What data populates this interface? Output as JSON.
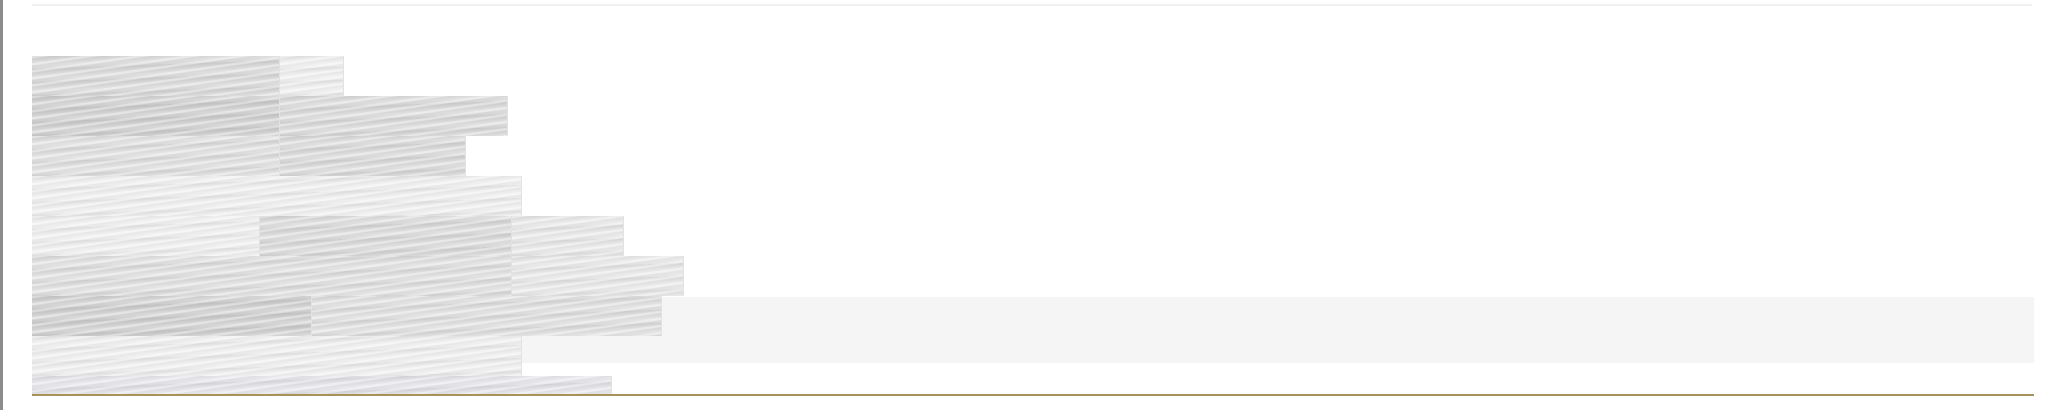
{
  "colors": {
    "page_background": "#ffffff",
    "left_border": "#8c8c8c",
    "stripe_background": "#f5f5f5",
    "bottom_rule": "#a6935a",
    "wood_base": "#dcdcdc"
  },
  "image": {
    "subject": "wood-floor-texture"
  }
}
